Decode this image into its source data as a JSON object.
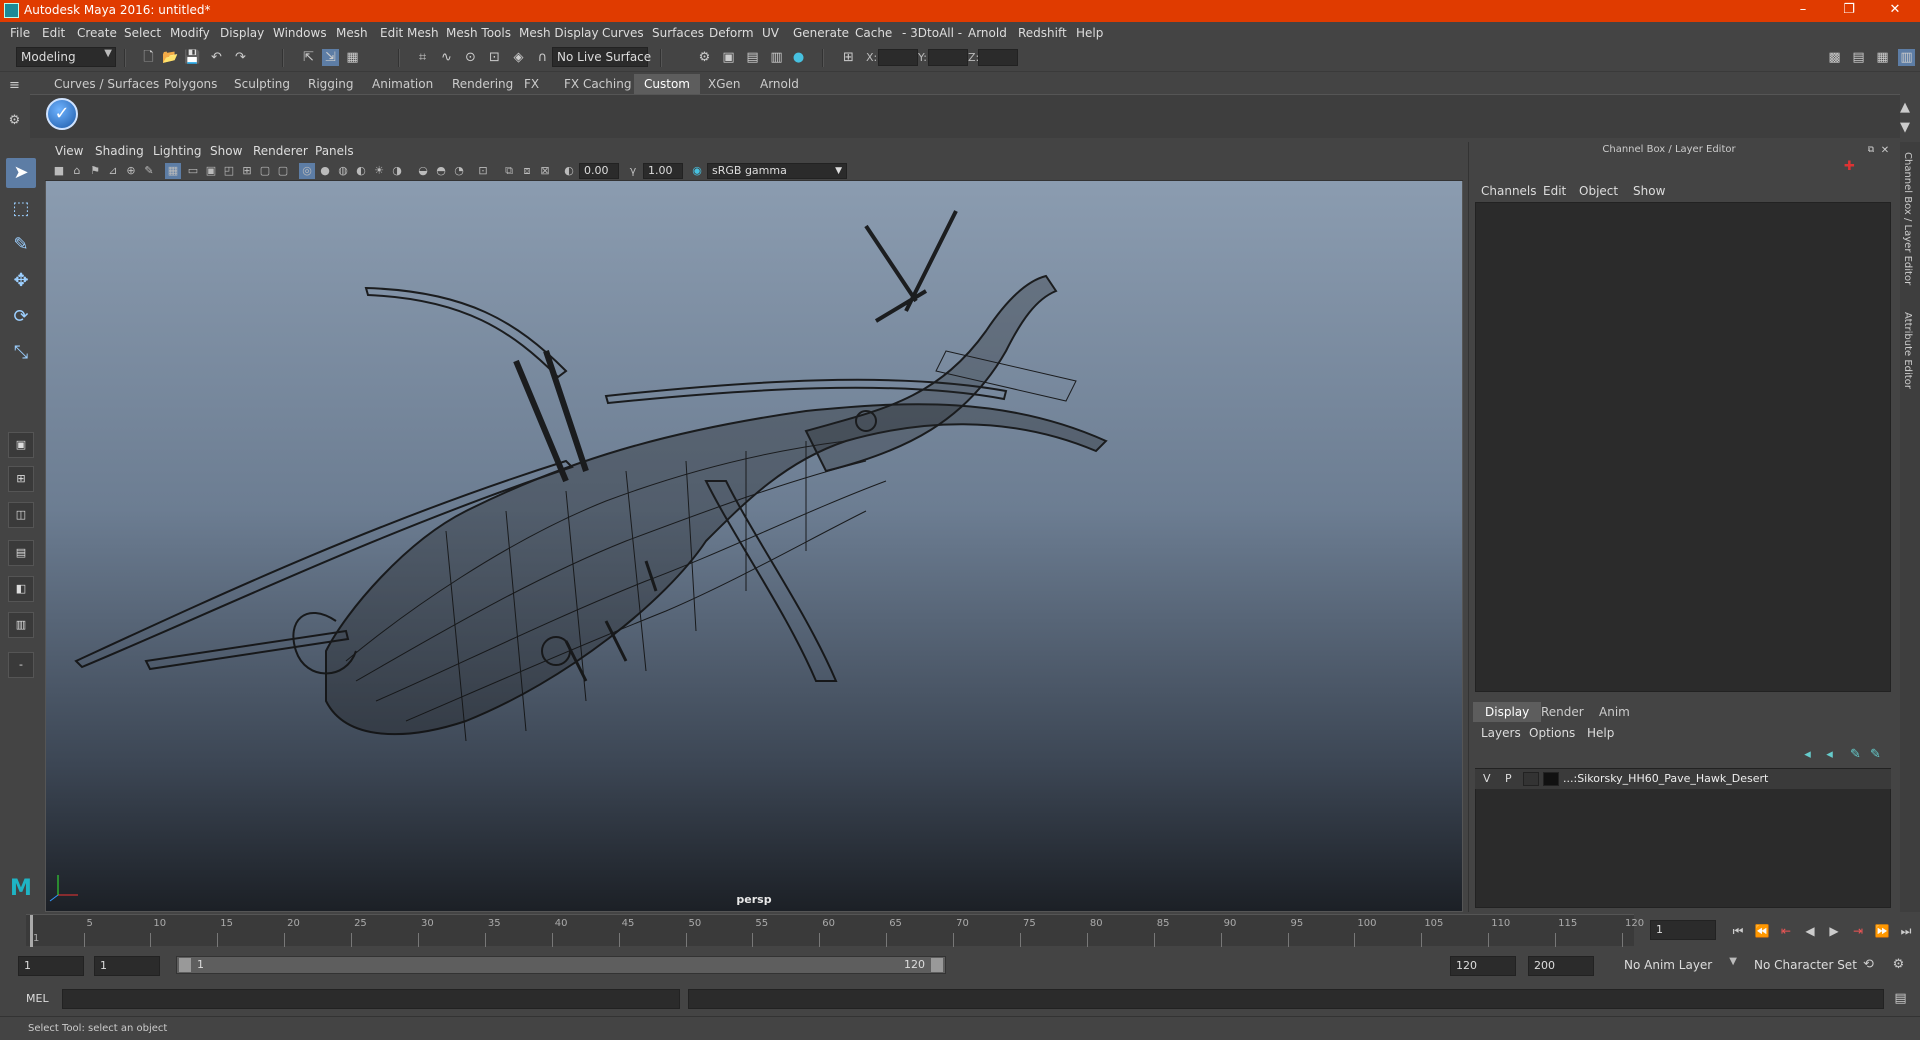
{
  "window": {
    "title": "Autodesk Maya 2016: untitled*",
    "minimize": "–",
    "restore": "❐",
    "close": "✕"
  },
  "menubar": [
    "File",
    "Edit",
    "Create",
    "Select",
    "Modify",
    "Display",
    "Windows",
    "Mesh",
    "Edit Mesh",
    "Mesh Tools",
    "Mesh Display",
    "Curves",
    "Surfaces",
    "Deform",
    "UV",
    "Generate",
    "Cache",
    "- 3DtoAll -",
    "Arnold",
    "Redshift",
    "Help"
  ],
  "statusline": {
    "menuset": "Modeling",
    "live_surface": "No Live Surface",
    "x_label": "X:",
    "y_label": "Y:",
    "z_label": "Z:"
  },
  "shelf": {
    "tabs": [
      "Curves / Surfaces",
      "Polygons",
      "Sculpting",
      "Rigging",
      "Animation",
      "Rendering",
      "FX",
      "FX Caching",
      "Custom",
      "XGen",
      "Arnold"
    ],
    "active_tab": "Custom"
  },
  "viewport": {
    "menu": [
      "View",
      "Shading",
      "Lighting",
      "Show",
      "Renderer",
      "Panels"
    ],
    "exposure": "0.00",
    "gamma": "1.00",
    "color_space": "sRGB gamma",
    "camera_label": "persp"
  },
  "channel_box": {
    "title": "Channel Box / Layer Editor",
    "menu": [
      "Channels",
      "Edit",
      "Object",
      "Show"
    ],
    "side_tabs": [
      "Channel Box / Layer Editor",
      "Attribute Editor"
    ]
  },
  "layer_editor": {
    "tabs": [
      "Display",
      "Render",
      "Anim"
    ],
    "active_tab": "Display",
    "menu": [
      "Layers",
      "Options",
      "Help"
    ],
    "layers": [
      {
        "v": "V",
        "p": "P",
        "name": "...:Sikorsky_HH60_Pave_Hawk_Desert"
      }
    ]
  },
  "timeline": {
    "ticks": [
      1,
      5,
      10,
      15,
      20,
      25,
      30,
      35,
      40,
      45,
      50,
      55,
      60,
      65,
      70,
      75,
      80,
      85,
      90,
      95,
      100,
      105,
      110,
      115,
      120
    ],
    "current_frame": "1"
  },
  "range": {
    "start": "1",
    "playback_start": "1",
    "slider_start": "1",
    "slider_end": "120",
    "playback_end": "120",
    "end": "200",
    "anim_layer": "No Anim Layer",
    "character_set": "No Character Set"
  },
  "command_line": {
    "label": "MEL"
  },
  "help_line": "Select Tool: select an object",
  "colors": {
    "titlebar": "#e03b00",
    "active_tool": "#5d7da5"
  }
}
